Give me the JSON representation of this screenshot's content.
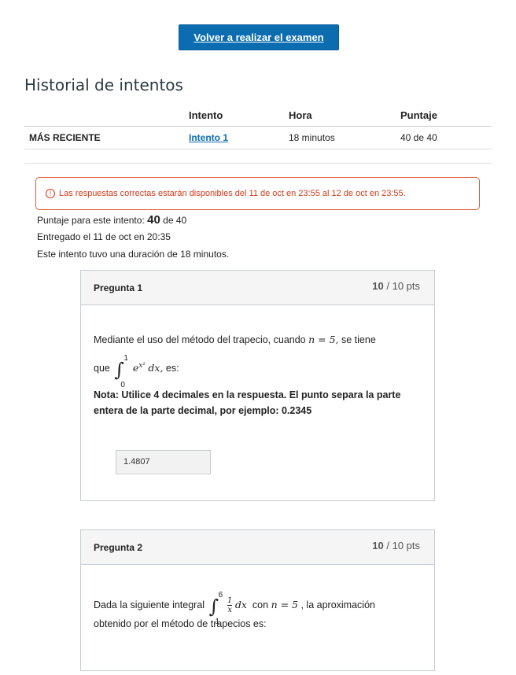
{
  "retake_button": "Volver a realizar el examen",
  "history": {
    "title": "Historial de intentos",
    "columns": [
      "",
      "Intento",
      "Hora",
      "Puntaje"
    ],
    "rows": [
      {
        "label": "MÁS RECIENTE",
        "attempt": "Intento 1",
        "time": "18 minutos",
        "score": "40 de 40"
      }
    ]
  },
  "alert": {
    "icon": "alert-circle-icon",
    "color": "#d13b1b",
    "text": "Las respuestas correctas estarán disponibles del 11 de oct en 23:55 al 12 de oct en 23:55."
  },
  "summary": {
    "score_prefix": "Puntaje para este intento:",
    "score_value": "40",
    "score_suffix": "de 40",
    "submitted": "Entregado el 11 de oct en 20:35",
    "duration": "Este intento tuvo una duración de 18 minutos."
  },
  "questions": [
    {
      "title": "Pregunta 1",
      "points_got": "10",
      "points_total": "/ 10 pts",
      "text_a": "Mediante el uso del método del trapecio, cuando",
      "n_expr": "n = 5,",
      "text_b": "se tiene",
      "text_c": "que",
      "integral_upper": "1",
      "integral_lower": "0",
      "integrand": "e",
      "exponent": "x²",
      "dx": "dx,",
      "text_d": "es:",
      "note": "Nota: Utilice 4 decimales en la respuesta. El punto separa la parte entera de la parte decimal, por ejemplo: 0.2345",
      "answer": "1.4807"
    },
    {
      "title": "Pregunta 2",
      "points_got": "10",
      "points_total": "/ 10 pts",
      "text_a": "Dada la siguiente integral",
      "integral_upper": "6",
      "integral_lower": "1",
      "frac_num": "1",
      "frac_den": "x",
      "dx": "dx",
      "text_b": "con",
      "n_expr": "n = 5",
      "text_c": ", la aproximación",
      "text_d": "obtenido por el método de trapecios es:"
    }
  ]
}
